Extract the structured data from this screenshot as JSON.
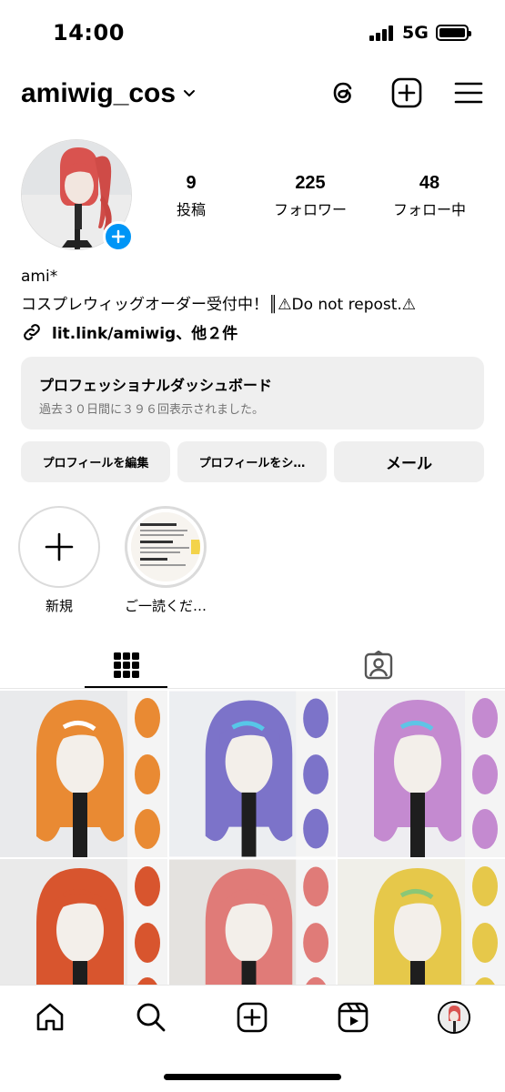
{
  "status_bar": {
    "time": "14:00",
    "network": "5G"
  },
  "header": {
    "username": "amiwig_cos"
  },
  "profile": {
    "stats": [
      {
        "value": "9",
        "label": "投稿"
      },
      {
        "value": "225",
        "label": "フォロワー"
      },
      {
        "value": "48",
        "label": "フォロー中"
      }
    ],
    "name": "ami*",
    "bio": "コスプレウィッグオーダー受付中！║⚠Do not repost.⚠",
    "link": "lit.link/amiwig、他２件"
  },
  "dashboard": {
    "title": "プロフェッショナルダッシュボード",
    "subtitle": "過去３０日間に３９６回表示されました。"
  },
  "buttons": {
    "edit": "プロフィールを編集",
    "share": "プロフィールをシ…",
    "mail": "メール"
  },
  "highlights": [
    {
      "label": "新規"
    },
    {
      "label": "ご一読くだ…"
    }
  ],
  "posts": [
    {
      "bg": "#e9eaec",
      "hair": "#e98a33",
      "accent": "#ffffff"
    },
    {
      "bg": "#eceef1",
      "hair": "#7c73c9",
      "accent": "#57c7e8"
    },
    {
      "bg": "#eeedf1",
      "hair": "#c48ad0",
      "accent": "#5fc4e6"
    },
    {
      "bg": "#eaeaea",
      "hair": "#d8552e",
      "accent": "#d8552e"
    },
    {
      "bg": "#e4e2df",
      "hair": "#e07b78",
      "accent": "#e07b78"
    },
    {
      "bg": "#f0efe9",
      "hair": "#e6c84a",
      "accent": "#8bc776"
    }
  ],
  "colors": {
    "accent_blue": "#0095f6",
    "button_bg": "#efefef",
    "muted_text": "#737373"
  }
}
